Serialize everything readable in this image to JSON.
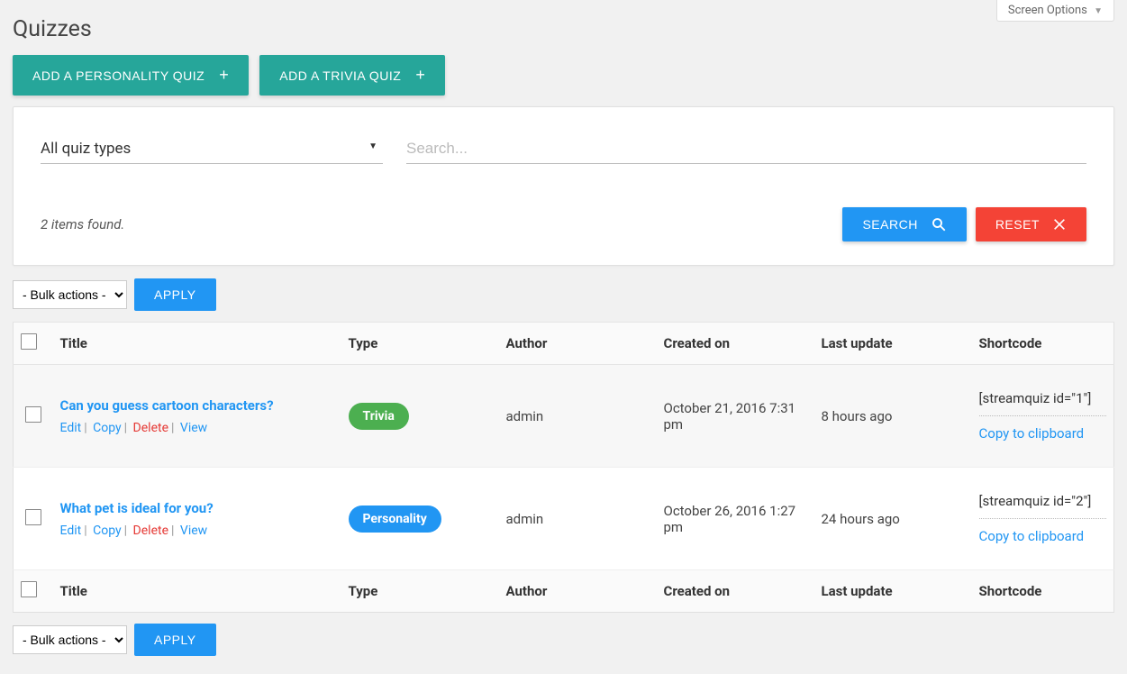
{
  "screen_options_label": "Screen Options",
  "page_title": "Quizzes",
  "add_buttons": {
    "personality_label": "ADD A PERSONALITY QUIZ",
    "trivia_label": "ADD A TRIVIA QUIZ"
  },
  "filters": {
    "quiz_type_selected": "All quiz types",
    "search_placeholder": "Search...",
    "items_found": "2 items found.",
    "search_btn": "SEARCH",
    "reset_btn": "RESET"
  },
  "bulk": {
    "select_label": "- Bulk actions -",
    "apply_label": "APPLY"
  },
  "columns": {
    "title": "Title",
    "type": "Type",
    "author": "Author",
    "created": "Created on",
    "updated": "Last update",
    "shortcode": "Shortcode"
  },
  "row_actions": {
    "edit": "Edit",
    "copy": "Copy",
    "delete": "Delete",
    "view": "View"
  },
  "copy_clipboard_label": "Copy to clipboard",
  "rows": [
    {
      "title": "Can you guess cartoon characters?",
      "type": "Trivia",
      "author": "admin",
      "created": "October 21, 2016 7:31 pm",
      "updated": "8 hours ago",
      "shortcode": "[streamquiz id=\"1\"]"
    },
    {
      "title": "What pet is ideal for you?",
      "type": "Personality",
      "author": "admin",
      "created": "October 26, 2016 1:27 pm",
      "updated": "24 hours ago",
      "shortcode": "[streamquiz id=\"2\"]"
    }
  ]
}
